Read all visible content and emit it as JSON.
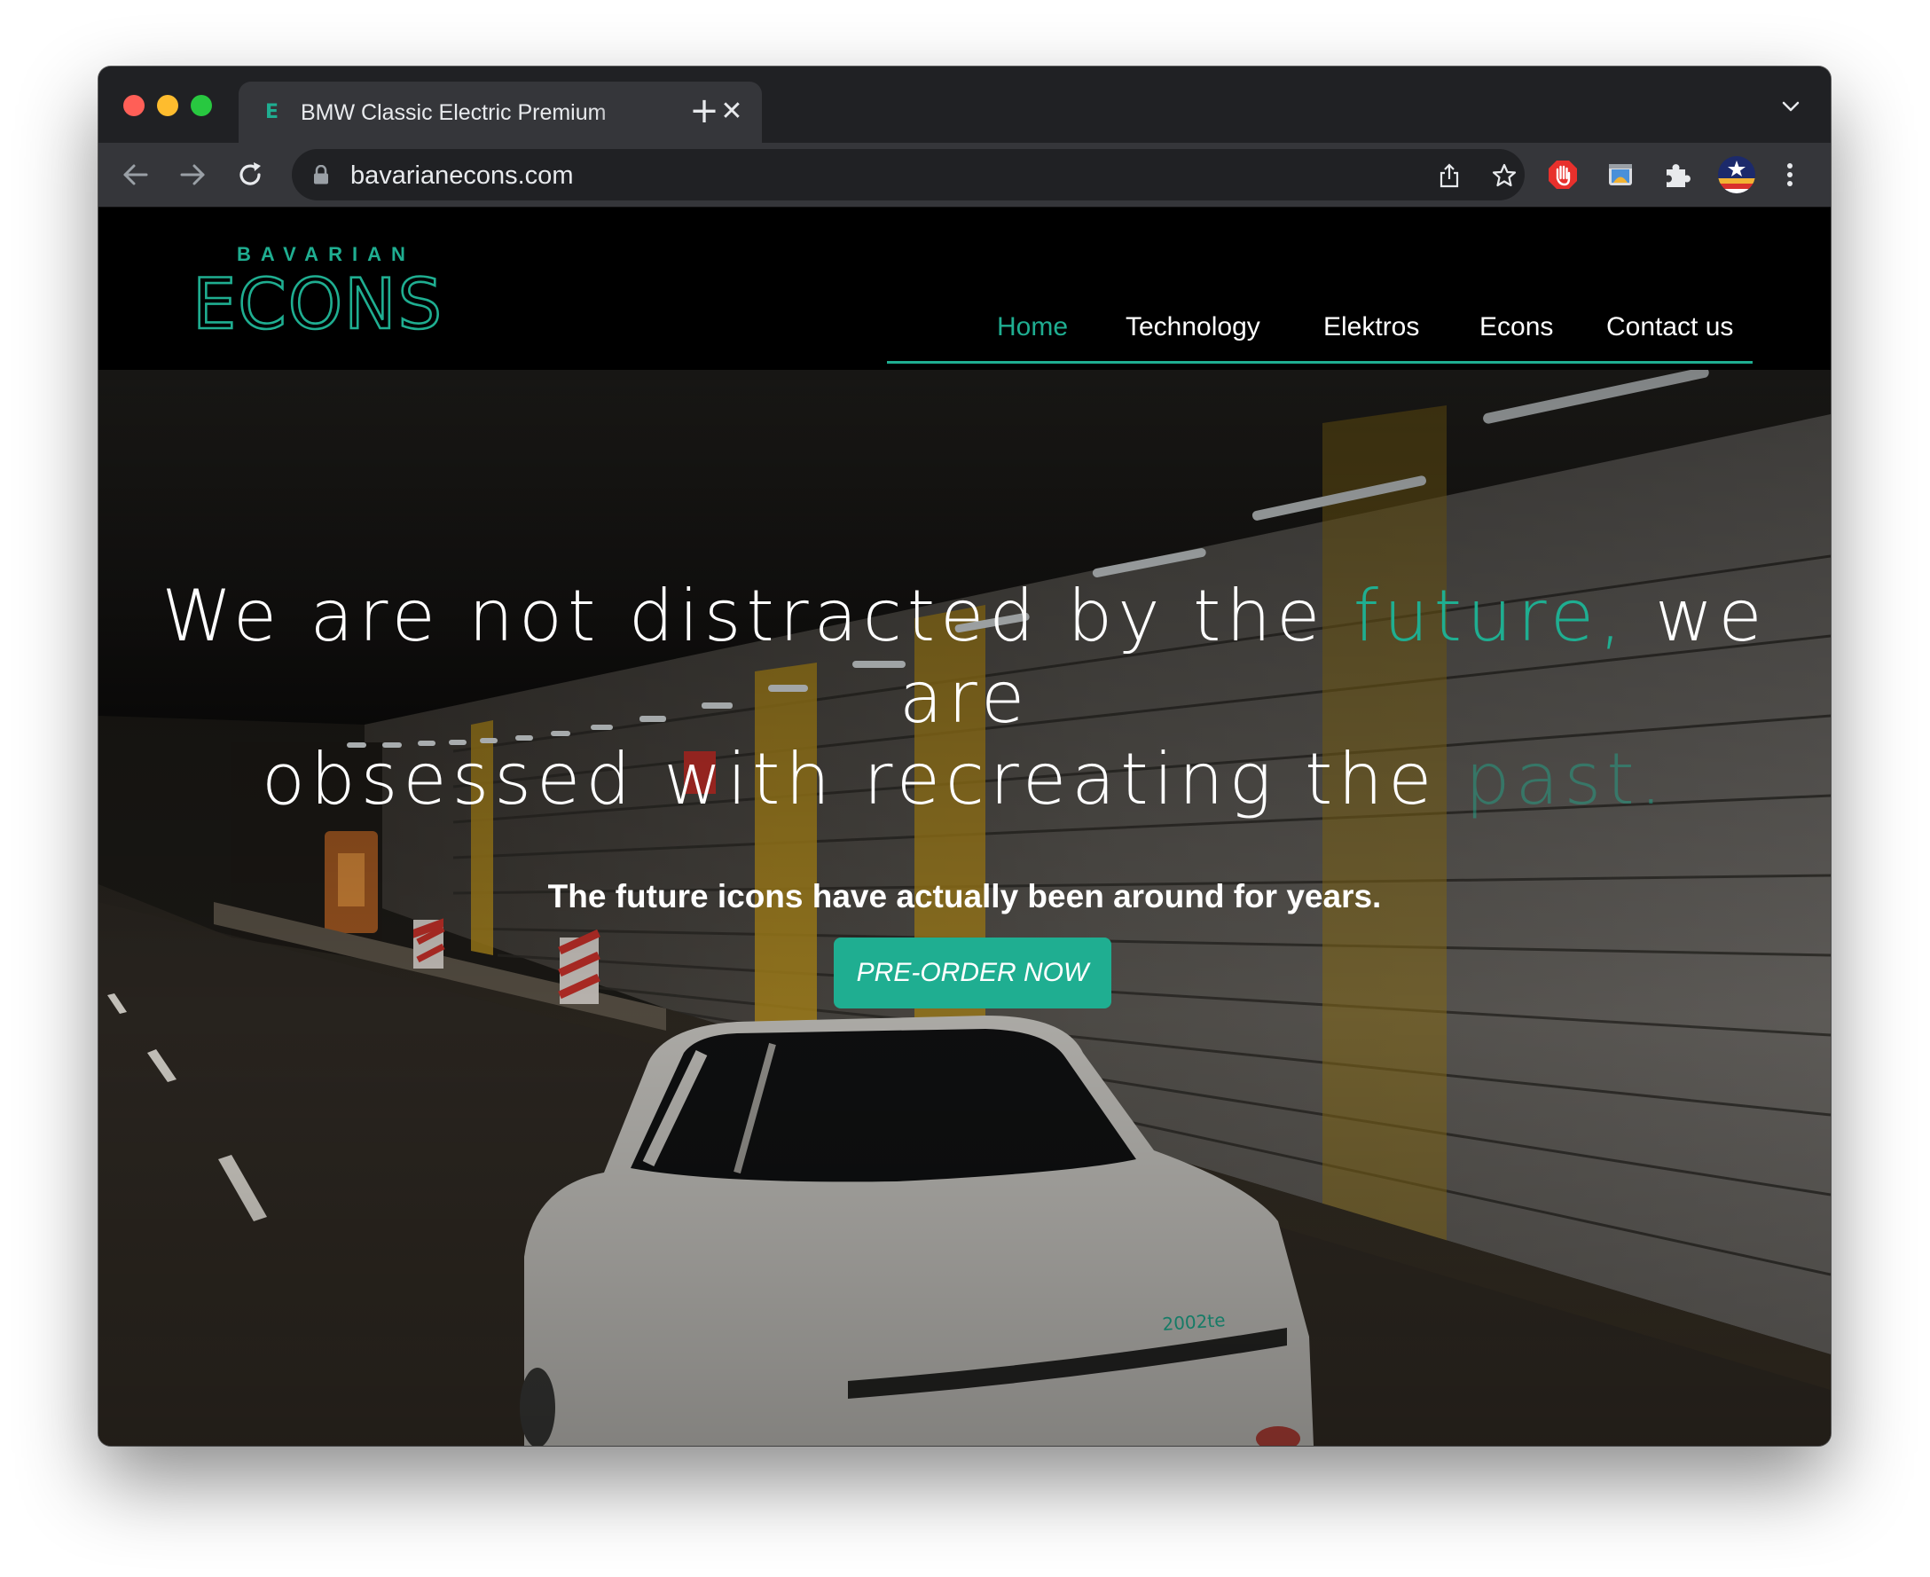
{
  "browser": {
    "tab_title": "BMW Classic Electric Premium",
    "tab_close": "✕",
    "new_tab": "+",
    "url": "bavarianecons.com",
    "icons": [
      "back-icon",
      "forward-icon",
      "reload-icon",
      "lock-icon",
      "share-icon",
      "bookmark-star-icon",
      "adblock-icon",
      "screenshot-extension-icon",
      "extensions-puzzle-icon",
      "profile-avatar-icon",
      "more-menu-icon",
      "tab-list-chevron-icon"
    ]
  },
  "site": {
    "logo_top": "BAVARIAN",
    "logo_main": "ECONS",
    "nav": {
      "home": "Home",
      "technology": "Technology",
      "elektros": "Elektros",
      "econs": "Econs",
      "contact": "Contact us"
    },
    "hero": {
      "line1_a": "We are not distracted by the ",
      "line1_accent": "future,",
      "line1_b": " we are",
      "line2_a": "obsessed with recreating the ",
      "line2_accent": "past.",
      "subline": "The future icons have actually been around for years.",
      "cta": "PRE-ORDER NOW",
      "car_badge": "2002te"
    }
  },
  "colors": {
    "accent": "#1fae91",
    "chrome_dark": "#202124",
    "chrome_mid": "#35363a"
  }
}
